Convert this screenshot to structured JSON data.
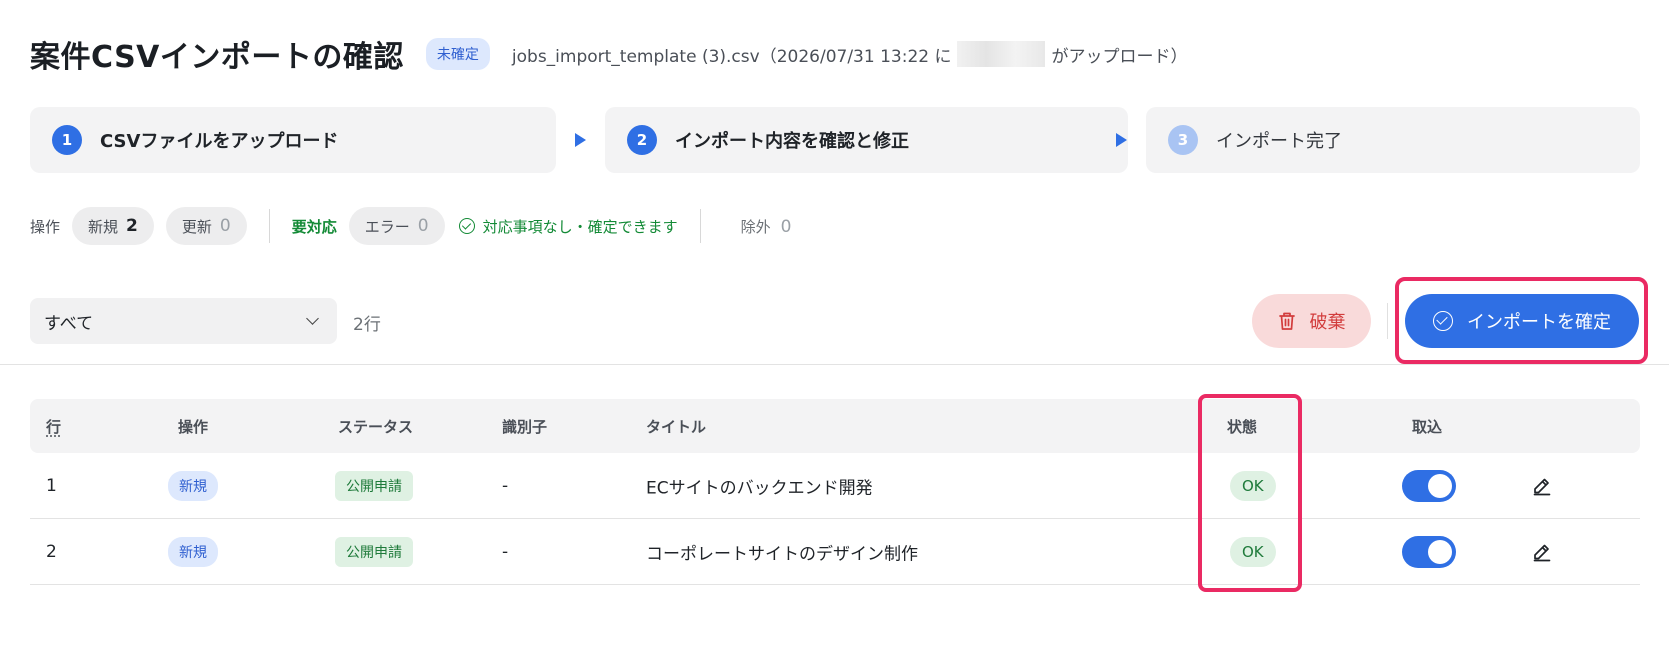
{
  "header": {
    "title": "案件CSVインポートの確認",
    "badge": "未確定",
    "upload_prefix": "jobs_import_template (3).csv（2026/07/31 13:22 に",
    "upload_suffix": "がアップロード）"
  },
  "stepper": {
    "steps": [
      {
        "num": "1",
        "label": "CSVファイルをアップロード",
        "state": "done"
      },
      {
        "num": "2",
        "label": "インポート内容を確認と修正",
        "state": "current"
      },
      {
        "num": "3",
        "label": "インポート完了",
        "state": "pending"
      }
    ]
  },
  "summary": {
    "operation_label": "操作",
    "new_label": "新規",
    "new_count": "2",
    "update_label": "更新",
    "update_count": "0",
    "attention_label": "要対応",
    "error_label": "エラー",
    "error_count": "0",
    "ok_note": "対応事項なし・確定できます",
    "excluded_label": "除外",
    "excluded_count": "0"
  },
  "toolbar": {
    "filter_value": "すべて",
    "row_count": "2行",
    "discard_label": "破棄",
    "confirm_label": "インポートを確定"
  },
  "table": {
    "headers": {
      "row": "行",
      "operation": "操作",
      "status": "ステータス",
      "identifier": "識別子",
      "title": "タイトル",
      "state": "状態",
      "import": "取込"
    },
    "rows": [
      {
        "row": "1",
        "operation": "新規",
        "status": "公開申請",
        "identifier": "-",
        "title": "ECサイトのバックエンド開発",
        "state": "OK",
        "import": true
      },
      {
        "row": "2",
        "operation": "新規",
        "status": "公開申請",
        "identifier": "-",
        "title": "コーポレートサイトのデザイン制作",
        "state": "OK",
        "import": true
      }
    ]
  },
  "colors": {
    "accent": "#2f6fe4",
    "highlight": "#ea2a63",
    "success": "#138a36",
    "danger": "#d23c3c"
  }
}
